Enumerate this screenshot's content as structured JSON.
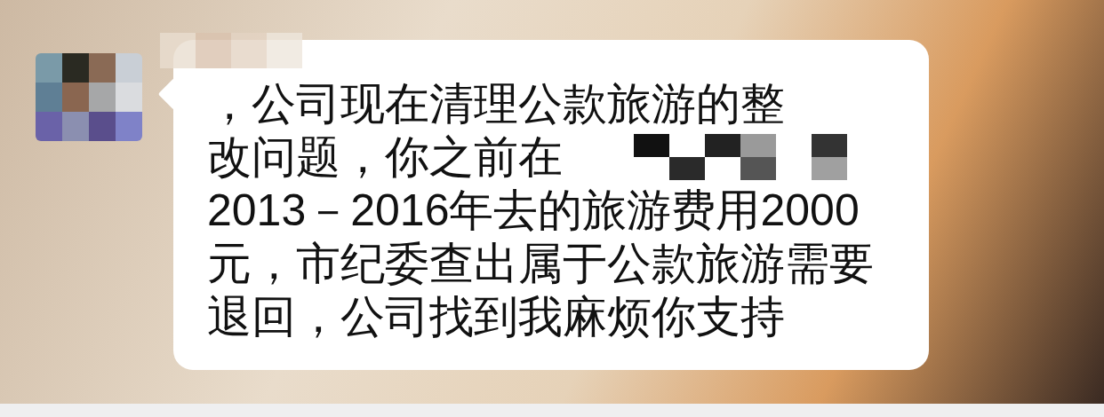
{
  "message": {
    "lines": [
      "，公司现在清理公款旅游的整",
      "改问题，你之前在",
      "2013－2016年去的旅游费用2000",
      "元，市纪委查出属于公款旅游需要",
      "退回，公司找到我麻烦你支持"
    ]
  }
}
